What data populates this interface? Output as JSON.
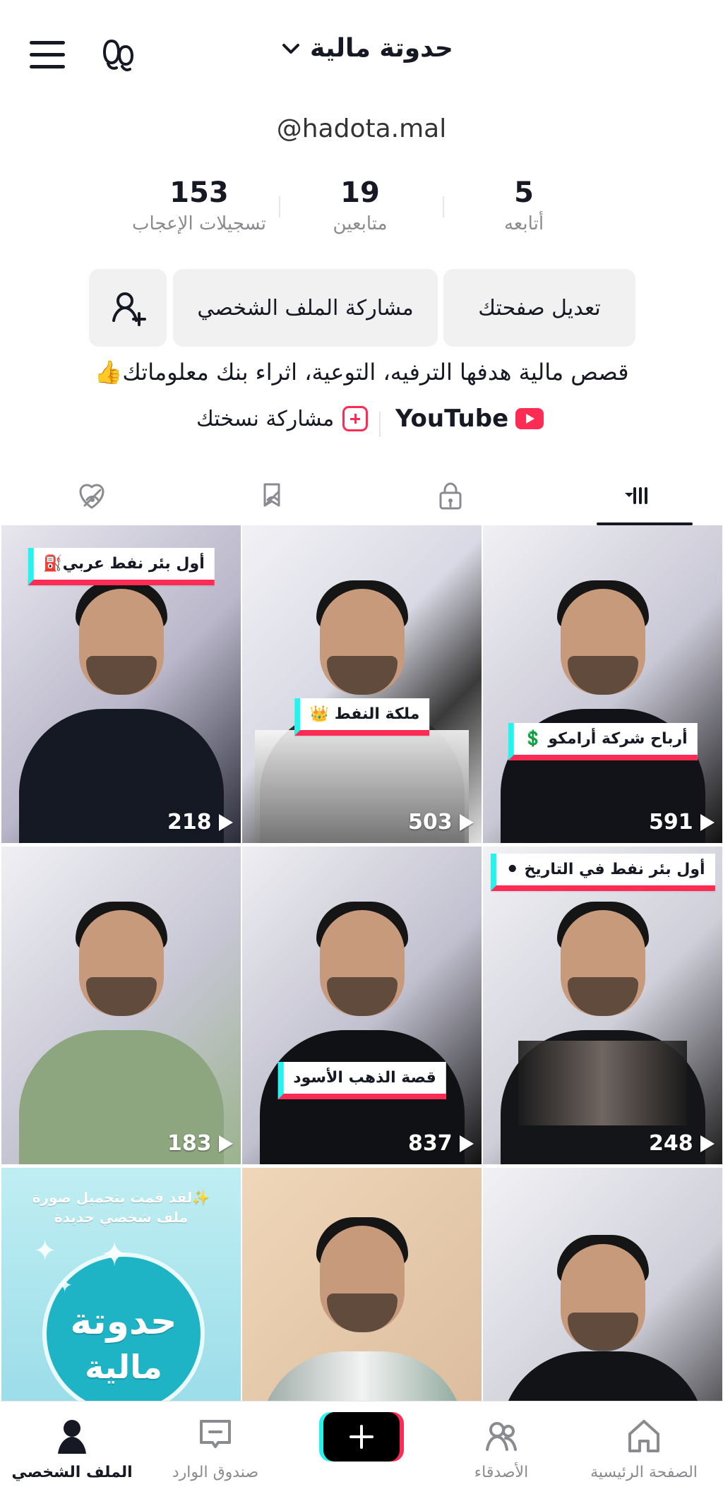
{
  "profile": {
    "title": "حدوتة مالية",
    "handle": "@hadota.mal",
    "stats": {
      "likes": {
        "value": "153",
        "label": "تسجيلات الإعجاب"
      },
      "followers": {
        "value": "19",
        "label": "متابعين"
      },
      "following": {
        "value": "5",
        "label": "أتابعه"
      }
    },
    "buttons": {
      "edit": "تعديل صفحتك",
      "share": "مشاركة الملف الشخصي"
    },
    "bio": "قصص مالية هدفها الترفيه، التوعية، اثراء بنك معلوماتك👍",
    "links": {
      "youtube": "YouTube",
      "share_copy": "مشاركة نسختك"
    }
  },
  "tabs": [
    "videos",
    "private",
    "saved",
    "liked"
  ],
  "grid": {
    "tiles": [
      {
        "label": "أول بئر نفط عربي⛽",
        "views": "218"
      },
      {
        "label": "ملكة النفط 👑",
        "views": "503"
      },
      {
        "label": "أرباح شركة أرامكو 💲",
        "views": "591"
      },
      {
        "label": "",
        "views": "183"
      },
      {
        "label": "قصة الذهب الأسود",
        "views": "837"
      },
      {
        "label": "أول بئر نفط في التاريخ ⚫",
        "views": "248"
      },
      {
        "label": "✨لقد قمت بتحميل صورة ملف شخصي جديدة",
        "views": ""
      },
      {
        "label": "",
        "views": ""
      },
      {
        "label": "",
        "views": ""
      }
    ]
  },
  "bottom_nav": {
    "home": "الصفحة الرئيسية",
    "friends": "الأصدقاء",
    "inbox": "صندوق الوارد",
    "profile": "الملف الشخصي"
  },
  "colors": {
    "accent": "#fe2c55",
    "cyan": "#25f4ee",
    "text": "#161823",
    "muted": "#8a8b91"
  }
}
